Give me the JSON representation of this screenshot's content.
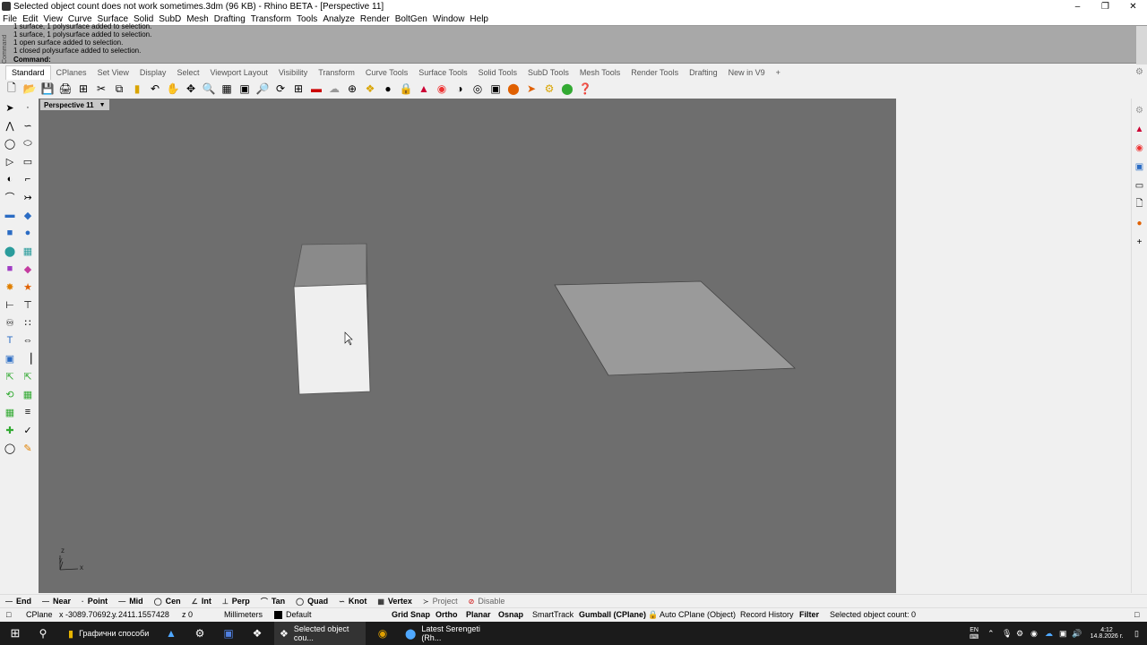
{
  "window": {
    "title": "Selected object count does not work sometimes.3dm (96 KB) - Rhino BETA - [Perspective 11]",
    "minimize_icon": "minimize-icon",
    "restore_icon": "restore-icon",
    "close_icon": "close-icon"
  },
  "menubar": [
    "File",
    "Edit",
    "View",
    "Curve",
    "Surface",
    "Solid",
    "SubD",
    "Mesh",
    "Drafting",
    "Transform",
    "Tools",
    "Analyze",
    "Render",
    "BoltGen",
    "Window",
    "Help"
  ],
  "command": {
    "side_label": "Command",
    "history": [
      "1 surface, 1 polysurface added to selection.",
      "1 surface, 1 polysurface added to selection.",
      "1 open surface added to selection.",
      "1 closed polysurface added to selection."
    ],
    "prompt": "Command:"
  },
  "tabs": [
    "Standard",
    "CPlanes",
    "Set View",
    "Display",
    "Select",
    "Viewport Layout",
    "Visibility",
    "Transform",
    "Curve Tools",
    "Surface Tools",
    "Solid Tools",
    "SubD Tools",
    "Mesh Tools",
    "Render Tools",
    "Drafting",
    "New in V9",
    "+"
  ],
  "active_tab": "Standard",
  "viewport": {
    "label": "Perspective 11",
    "axis_z": "z",
    "axis_y": "y",
    "axis_x": "x"
  },
  "osnaps": [
    {
      "label": "End",
      "on": true
    },
    {
      "label": "Near",
      "on": true
    },
    {
      "label": "Point",
      "on": true
    },
    {
      "label": "Mid",
      "on": true
    },
    {
      "label": "Cen",
      "on": true
    },
    {
      "label": "Int",
      "on": true
    },
    {
      "label": "Perp",
      "on": true
    },
    {
      "label": "Tan",
      "on": true
    },
    {
      "label": "Quad",
      "on": true
    },
    {
      "label": "Knot",
      "on": true
    },
    {
      "label": "Vertex",
      "on": true
    },
    {
      "label": "Project",
      "on": false
    },
    {
      "label": "Disable",
      "on": false
    }
  ],
  "status": {
    "cplane": "CPlane",
    "x": "x -3089.70692...",
    "y": "y 2411.1557428",
    "z": "z 0",
    "units": "Millimeters",
    "layer": "Default",
    "grid_snap": "Grid Snap",
    "ortho": "Ortho",
    "planar": "Planar",
    "osnap": "Osnap",
    "smarttrack": "SmartTrack",
    "gumball": "Gumball (CPlane)",
    "auto_cplane": "Auto CPlane (Object)",
    "record_history": "Record History",
    "filter": "Filter",
    "selected_count": "Selected object count: 0"
  },
  "taskbar": {
    "items": [
      "Графични способи",
      "Selected object cou...",
      "Latest Serengeti (Rh..."
    ],
    "lang": "EN",
    "time": "4:12",
    "date": "14.8.2026 г."
  }
}
